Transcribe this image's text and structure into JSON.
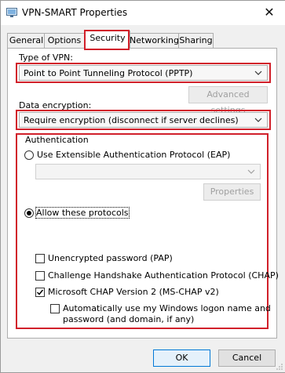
{
  "window": {
    "title": "VPN-SMART Properties",
    "close_glyph": "✕"
  },
  "tabs": [
    {
      "label": "General"
    },
    {
      "label": "Options"
    },
    {
      "label": "Security"
    },
    {
      "label": "Networking"
    },
    {
      "label": "Sharing"
    }
  ],
  "security": {
    "vpn_type_label": "Type of VPN:",
    "vpn_type_value": "Point to Point Tunneling Protocol (PPTP)",
    "advanced_settings_label": "Advanced settings",
    "encryption_label": "Data encryption:",
    "encryption_value": "Require encryption (disconnect if server declines)",
    "auth": {
      "group_title": "Authentication",
      "eap_radio_label": "Use Extensible Authentication Protocol (EAP)",
      "eap_dropdown_value": "",
      "properties_label": "Properties",
      "allow_radio_label": "Allow these protocols",
      "protocols": [
        {
          "label": "Unencrypted password (PAP)",
          "checked": false
        },
        {
          "label": "Challenge Handshake Authentication Protocol (CHAP)",
          "checked": false
        },
        {
          "label": "Microsoft CHAP Version 2 (MS-CHAP v2)",
          "checked": true
        }
      ],
      "auto_logon_line1": "Automatically use my Windows logon name and",
      "auto_logon_line2": "password (and domain, if any)",
      "auto_logon_checked": false
    }
  },
  "footer": {
    "ok_label": "OK",
    "cancel_label": "Cancel"
  },
  "colors": {
    "highlight": "#d1202a",
    "background": "#f0f0f0"
  }
}
